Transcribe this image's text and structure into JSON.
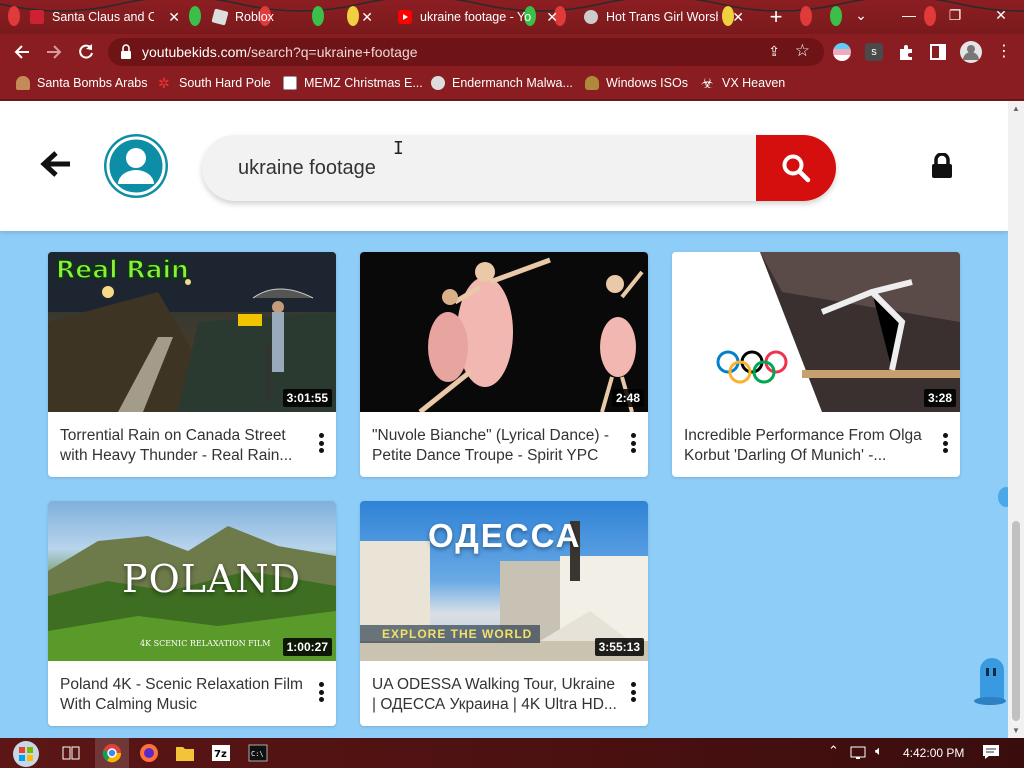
{
  "browser": {
    "tabs": [
      {
        "label": "Santa Claus and Christ",
        "favicon": "santa-favicon"
      },
      {
        "label": "Roblox",
        "favicon": "roblox-favicon"
      },
      {
        "label": "ukraine footage - YouT",
        "favicon": "youtube-favicon",
        "active": true
      },
      {
        "label": "Hot Trans Girl Worship",
        "favicon": "site-favicon"
      }
    ],
    "new_tab_label": "+",
    "window_controls": {
      "menu": "⌄",
      "minimize": "—",
      "restore": "❐",
      "close": "✕"
    },
    "url_domain": "youtubekids.com",
    "url_path": "/search?q=ukraine+footage",
    "bookmarks": [
      {
        "label": "Santa Bombs Arabs",
        "icon": "person-icon"
      },
      {
        "label": "South Hard Pole",
        "icon": "snowflake-icon"
      },
      {
        "label": "MEMZ Christmas E...",
        "icon": "page-icon"
      },
      {
        "label": "Endermanch Malwa...",
        "icon": "skull-icon"
      },
      {
        "label": "Windows ISOs",
        "icon": "figure-icon"
      },
      {
        "label": "VX Heaven",
        "icon": "biohazard-icon"
      }
    ]
  },
  "kids": {
    "search_query": "ukraine footage",
    "accent_red": "#d50e0e",
    "avatar_color": "#0d8ea6",
    "background": "#8ecdf8"
  },
  "videos": [
    {
      "title": "Torrential Rain on Canada Street with Heavy Thunder - Real Rain...",
      "duration": "3:01:55",
      "thumb_text": "Real Rain"
    },
    {
      "title": "\"Nuvole Bianche\" (Lyrical Dance) - Petite Dance Troupe - Spirit YPC",
      "duration": "2:48"
    },
    {
      "title": "Incredible Performance From Olga Korbut 'Darling Of Munich' -...",
      "duration": "3:28"
    },
    {
      "title": "Poland 4K - Scenic Relaxation Film With Calming Music",
      "duration": "1:00:27",
      "thumb_text": "POLAND",
      "thumb_subtext": "4K SCENIC RELAXATION FILM"
    },
    {
      "title": "UA ODESSA Walking Tour, Ukraine | ОДЕССА Украина | 4K Ultra HD...",
      "duration": "3:55:13",
      "thumb_text": "ОДЕССА",
      "thumb_subtext": "EXPLORE THE WORLD"
    }
  ],
  "taskbar": {
    "clock": "4:42:00 PM",
    "apps": [
      "task-view",
      "chrome",
      "firefox",
      "file-explorer",
      "7zip",
      "command-prompt"
    ]
  }
}
